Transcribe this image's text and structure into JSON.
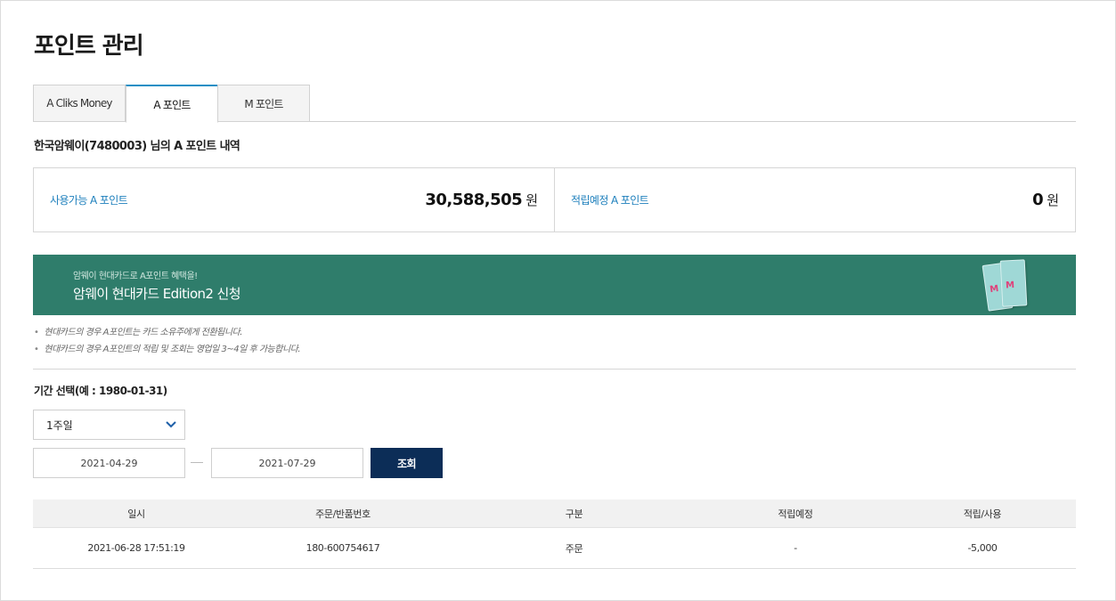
{
  "page": {
    "title": "포인트 관리"
  },
  "tabs": [
    {
      "label": "A Cliks Money"
    },
    {
      "label": "A 포인트"
    },
    {
      "label": "M 포인트"
    }
  ],
  "owner_line": "한국암웨이(7480003) 님의 A 포인트 내역",
  "summary": {
    "available": {
      "label": "사용가능 A 포인트",
      "value": "30,588,505",
      "unit": "원"
    },
    "pending": {
      "label": "적립예정 A 포인트",
      "value": "0",
      "unit": "원"
    }
  },
  "banner": {
    "subtitle": "암웨이 현대카드로 A포인트 혜택을!",
    "title": "암웨이 현대카드 Edition2 신청",
    "card_letter": "M"
  },
  "notes": [
    "현대카드의 경우 A포인트는 카드 소유주에게 전환됩니다.",
    "현대카드의 경우 A포인트의 적립 및 조회는 영업일 3~4일 후 가능합니다."
  ],
  "period": {
    "label": "기간 선택(예 : 1980-01-31)",
    "selected": "1주일",
    "start_date": "2021-04-29",
    "end_date": "2021-07-29",
    "search_label": "조회"
  },
  "table": {
    "headers": [
      "일시",
      "주문/반품번호",
      "구분",
      "적립예정",
      "적립/사용"
    ],
    "rows": [
      [
        "2021-06-28 17:51:19",
        "180-600754617",
        "주문",
        "-",
        "-5,000"
      ]
    ]
  },
  "colors": {
    "accent_blue": "#1d7fbc",
    "tab_active_border": "#1d8ec5",
    "banner_green": "#2f7d6b",
    "button_navy": "#0c2d57"
  },
  "icons": {
    "select_arrow": "chevron-down-icon"
  }
}
